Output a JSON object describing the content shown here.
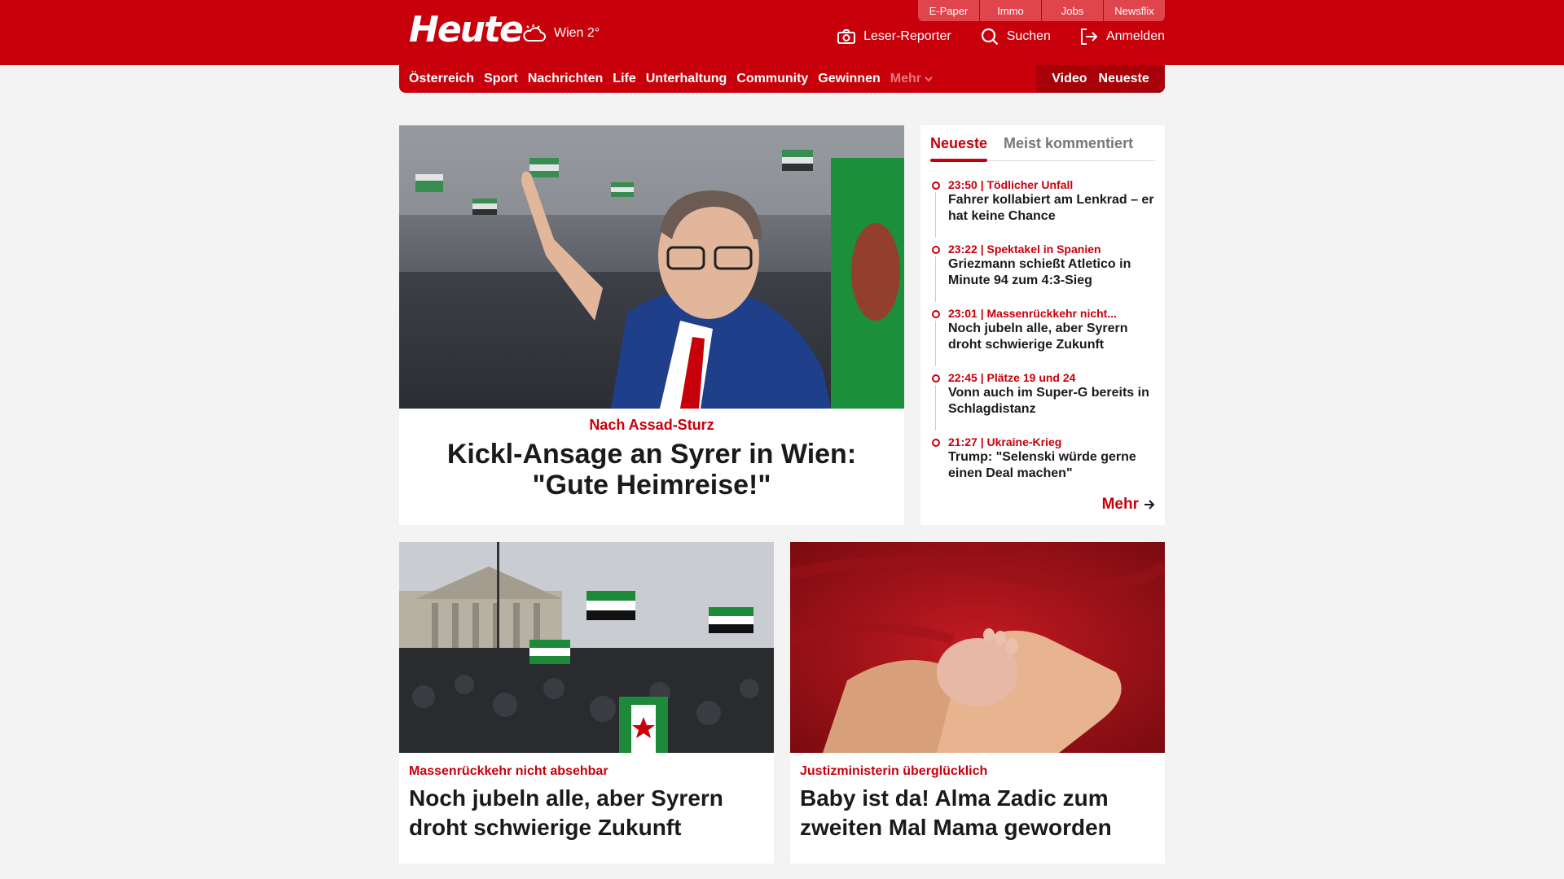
{
  "header": {
    "logo": "Heute",
    "weather": "Wien 2°",
    "quicklinks": [
      "E-Paper",
      "Immo",
      "Jobs",
      "Newsflix"
    ],
    "leser_reporter": "Leser-Reporter",
    "search": "Suchen",
    "login": "Anmelden"
  },
  "nav": {
    "items": [
      "Österreich",
      "Sport",
      "Nachrichten",
      "Life",
      "Unterhaltung",
      "Community",
      "Gewinnen"
    ],
    "more": "Mehr",
    "video": "Video",
    "newest": "Neueste"
  },
  "hero": {
    "kicker": "Nach Assad-Sturz",
    "title": "Kickl-Ansage an Syrer in Wien: \"Gute Heimreise!\""
  },
  "sidebar": {
    "tabs": [
      "Neueste",
      "Meist kommentiert"
    ],
    "items": [
      {
        "meta": "23:50 | Tödlicher Unfall",
        "title": "Fahrer kollabiert am Lenkrad – er hat keine Chance"
      },
      {
        "meta": "23:22 | Spektakel in Spanien",
        "title": "Griezmann schießt Atletico in Minute 94 zum 4:3-Sieg"
      },
      {
        "meta": "23:01 | Massenrückkehr nicht...",
        "title": "Noch jubeln alle, aber Syrern droht schwierige Zukunft"
      },
      {
        "meta": "22:45 | Plätze 19 und 24",
        "title": "Vonn auch im Super-G bereits in Schlagdistanz"
      },
      {
        "meta": "21:27 | Ukraine-Krieg",
        "title": "Trump: \"Selenski würde gerne einen Deal machen\""
      }
    ],
    "more": "Mehr"
  },
  "cards": [
    {
      "kicker": "Massenrückkehr nicht absehbar",
      "title": "Noch jubeln alle, aber Syrern droht schwierige Zukunft"
    },
    {
      "kicker": "Justizministerin überglücklich",
      "title": "Baby ist da! Alma Zadic zum zweiten Mal Mama geworden"
    }
  ],
  "colors": {
    "brand": "#c8000b",
    "brand_dark": "#a70009",
    "background": "#f3f3f3"
  },
  "icons": [
    "weather-cloud-sun-icon",
    "camera-icon",
    "search-icon",
    "login-icon",
    "chevron-down-icon",
    "arrow-right-icon"
  ]
}
